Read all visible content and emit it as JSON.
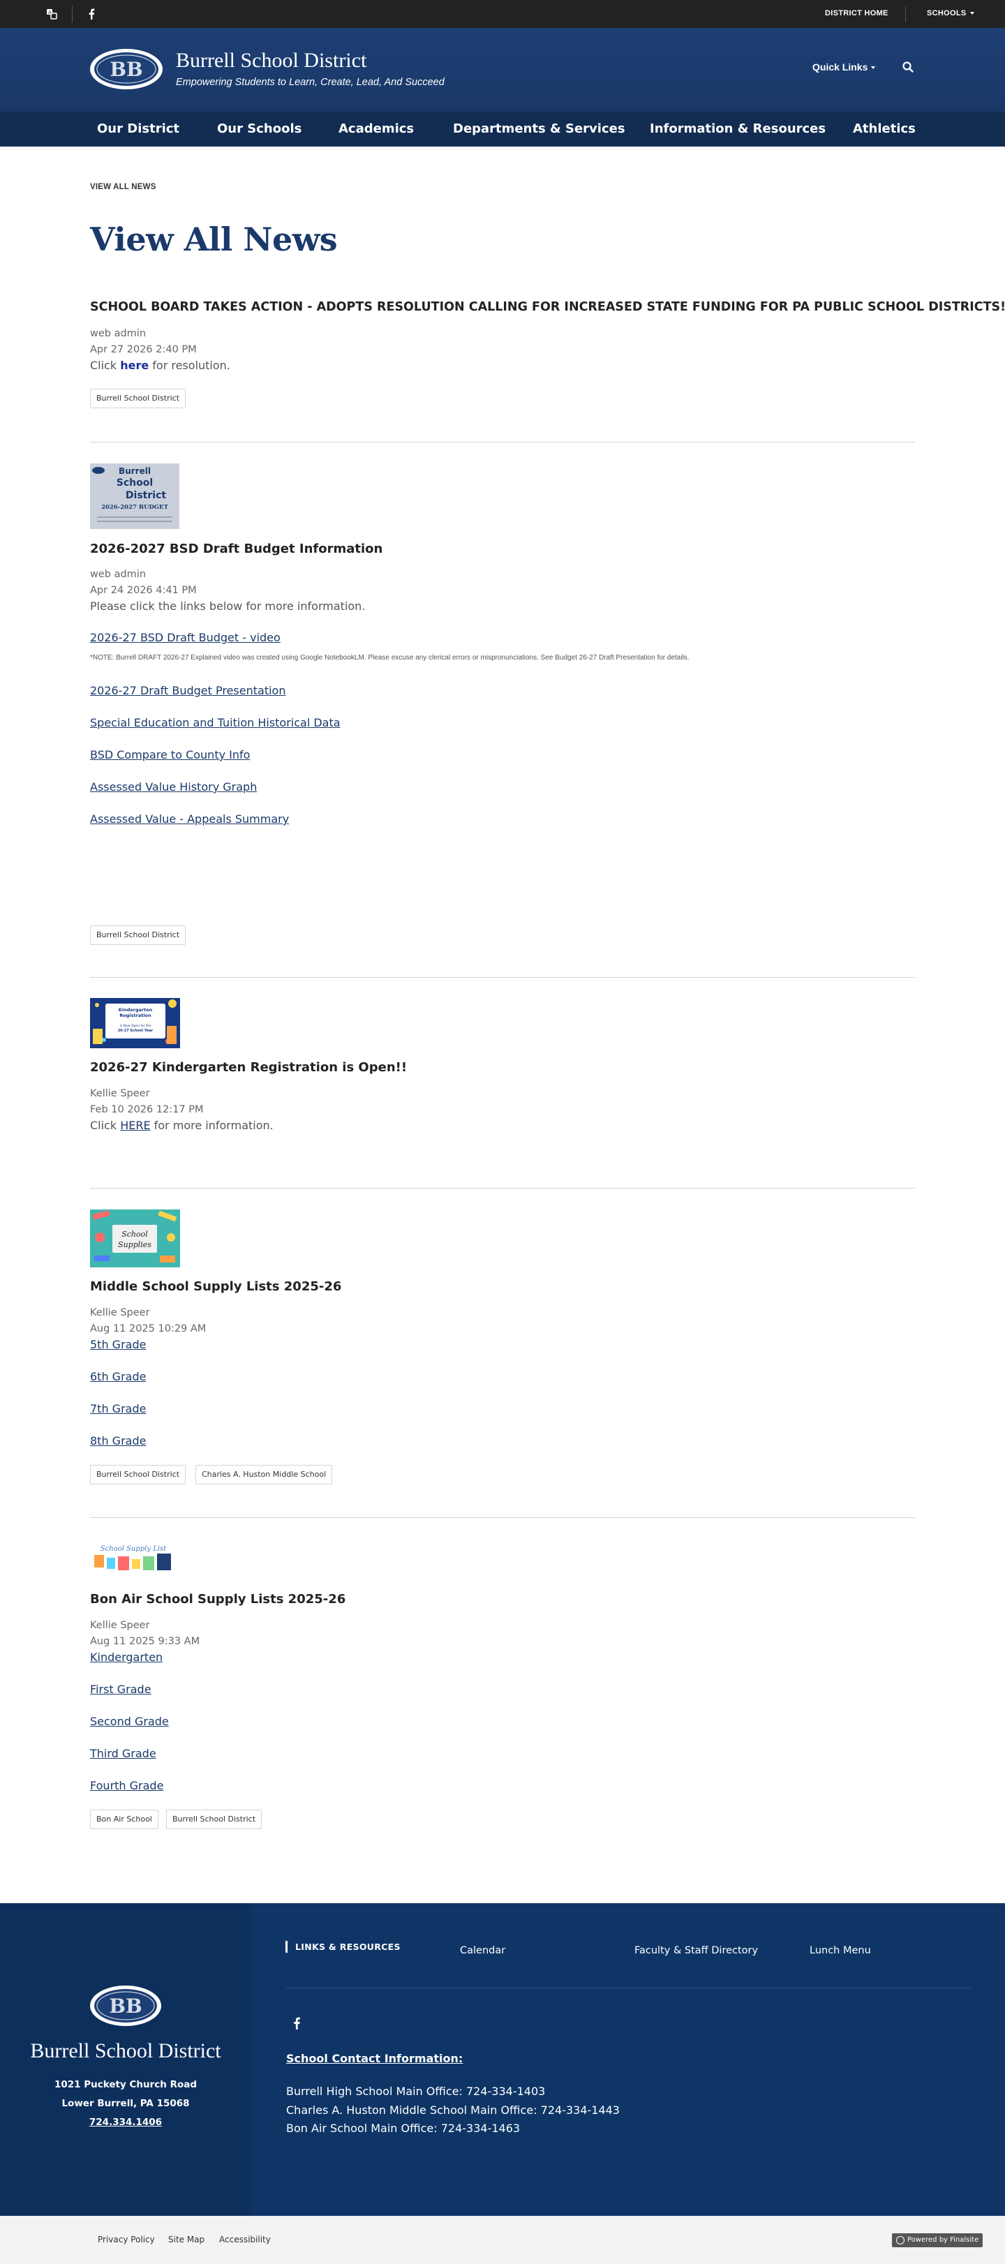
{
  "utility": {
    "district_home": "DISTRICT HOME",
    "schools": "SCHOOLS"
  },
  "header": {
    "title": "Burrell School District",
    "tagline": "Empowering Students to Learn, Create, Lead, And Succeed",
    "quick_links": "Quick Links",
    "logo_letters": "BB"
  },
  "nav": {
    "items": [
      "Our District",
      "Our Schools",
      "Academics",
      "Departments & Services",
      "Information & Resources",
      "Athletics"
    ]
  },
  "breadcrumb": "VIEW ALL NEWS",
  "page_title": "View All News",
  "posts": [
    {
      "title": "SCHOOL BOARD TAKES ACTION - ADOPTS RESOLUTION CALLING FOR INCREASED STATE FUNDING FOR PA PUBLIC SCHOOL DISTRICTS!",
      "author": "web admin",
      "date": "Apr 27 2026 2:40 PM",
      "body_before": "Click ",
      "body_link": "here",
      "body_after": " for resolution.",
      "tags": [
        "Burrell School District"
      ]
    },
    {
      "title": "2026-2027 BSD Draft Budget Information",
      "author": "web admin",
      "date": "Apr 24 2026 4:41 PM",
      "body": "Please click the links below for more information.",
      "thumb": {
        "line1": "Burrell",
        "line2": "School",
        "line3": "District",
        "line4": "2026-2027 BUDGET"
      },
      "links": [
        "2026-27 BSD Draft Budget - video",
        "2026-27 Draft Budget Presentation",
        "Special Education and Tuition Historical Data",
        "BSD Compare to County Info",
        "Assessed Value History Graph",
        "Assessed Value - Appeals Summary"
      ],
      "note": "*NOTE: Burrell DRAFT 2026-27 Explained video was created using Google NotebookLM.  Please excuse any clerical errors or mispronunciations.  See Budget 26-27 Draft Presentation for details.",
      "tags": [
        "Burrell School District"
      ]
    },
    {
      "title": "2026-27 Kindergarten Registration is Open!!",
      "author": "Kellie Speer",
      "date": "Feb 10 2026 12:17 PM",
      "body_before": "Click ",
      "body_link": "HERE",
      "body_after": " for more information.",
      "thumb": {
        "line1": "Kindergarten",
        "line2": "Registration",
        "line3": "is Now Open for the",
        "line4": "26-27 School Year"
      }
    },
    {
      "title": "Middle School Supply Lists 2025-26",
      "author": "Kellie Speer",
      "date": "Aug 11 2025 10:29 AM",
      "thumb": {
        "line1": "School",
        "line2": "Supplies"
      },
      "links": [
        "5th Grade",
        "6th Grade",
        "7th Grade",
        "8th Grade"
      ],
      "tags": [
        "Burrell School District",
        "Charles A. Huston Middle School"
      ]
    },
    {
      "title": "Bon Air School Supply Lists 2025-26",
      "author": "Kellie Speer",
      "date": "Aug 11 2025 9:33 AM",
      "thumb": {
        "line1": "School Supply List"
      },
      "links": [
        "Kindergarten",
        "First Grade",
        "Second Grade ",
        "Third Grade",
        "Fourth Grade"
      ],
      "tags": [
        "Bon Air School",
        "Burrell School District"
      ]
    }
  ],
  "footer": {
    "name": "Burrell School District",
    "address1": "1021 Puckety Church Road",
    "address2": "Lower Burrell, PA  15068",
    "phone": "724.334.1406",
    "links_heading": "LINKS & RESOURCES",
    "links": [
      "Calendar",
      "Faculty & Staff Directory",
      "Lunch Menu"
    ],
    "contact_heading": "School Contact Information:",
    "contacts": [
      "Burrell High School Main Office:  724-334-1403",
      "Charles A. Huston Middle School Main Office:  724-334-1443",
      "Bon Air School Main Office:  724-334-1463"
    ]
  },
  "bottom": {
    "links": [
      "Privacy Policy",
      "Site Map",
      "Accessibility"
    ],
    "powered": "Powered by Finalsite"
  },
  "colors": {
    "brand_navy": "#1b3a6b",
    "header_bg": "#1e3f75",
    "nav_bg": "#122c52",
    "footer_bg": "#0e3566",
    "utility_bg": "#222222"
  }
}
